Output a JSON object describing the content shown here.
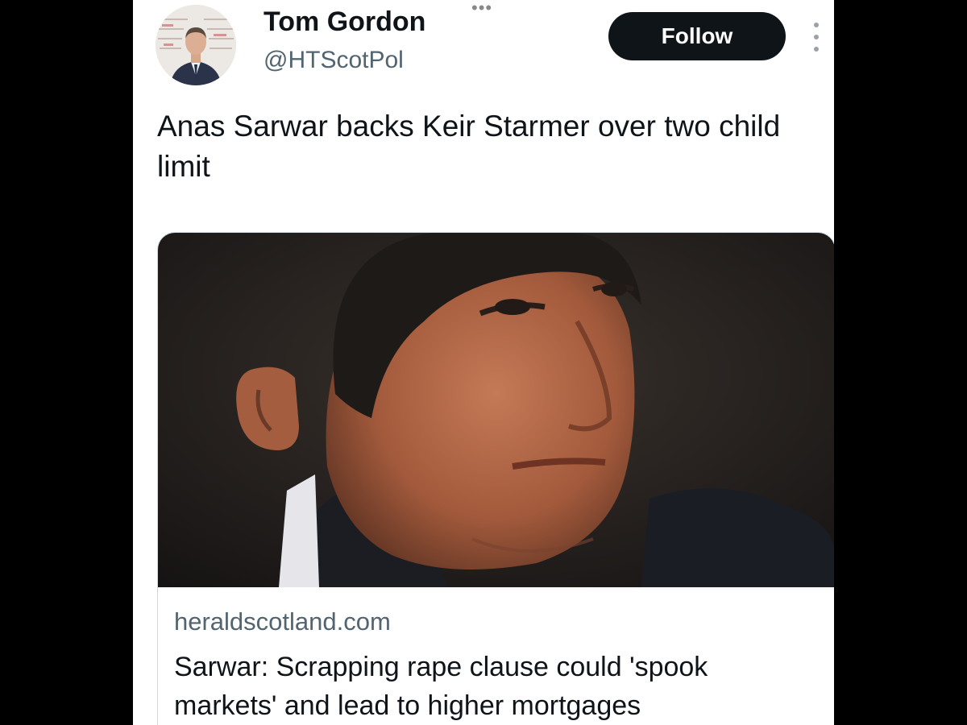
{
  "tweet": {
    "author": {
      "display_name": "Tom Gordon",
      "handle": "@HTScotPol"
    },
    "follow_label": "Follow",
    "top_dots": "•••",
    "text": "Anas Sarwar backs Keir Starmer over two child limit"
  },
  "link_card": {
    "domain": "heraldscotland.com",
    "title": "Sarwar: Scrapping rape clause could 'spook markets' and lead to higher mortgages"
  },
  "colors": {
    "background": "#000000",
    "panel": "#ffffff",
    "follow_button": "#0f1419",
    "secondary_text": "#536471",
    "card_border": "#cfd9de"
  },
  "icons": {
    "more": "vertical-ellipsis-icon"
  }
}
